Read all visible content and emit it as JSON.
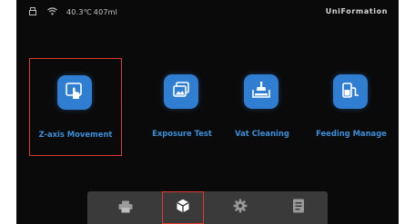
{
  "status": {
    "temperature": "40.3℃",
    "volume": "407ml",
    "brand": "UniFormation"
  },
  "menu": {
    "items": [
      {
        "label": "Z-axis Movement",
        "icon": "hand-pointer-icon",
        "selected": true
      },
      {
        "label": "Exposure Test",
        "icon": "photos-icon",
        "selected": false
      },
      {
        "label": "Vat Cleaning",
        "icon": "vat-brush-icon",
        "selected": false
      },
      {
        "label": "Feeding Manage",
        "icon": "bottle-feed-icon",
        "selected": false
      }
    ]
  },
  "nav": {
    "items": [
      {
        "icon": "printer-icon",
        "active": false
      },
      {
        "icon": "tools-cube-icon",
        "active": true
      },
      {
        "icon": "gear-icon",
        "active": false
      },
      {
        "icon": "document-icon",
        "active": false
      }
    ]
  },
  "colors": {
    "background": "#0a0a0a",
    "accent": "#2f7ed2",
    "label": "#3f8ed8",
    "highlight": "#e0392b",
    "navbar": "#3a3a3a"
  }
}
